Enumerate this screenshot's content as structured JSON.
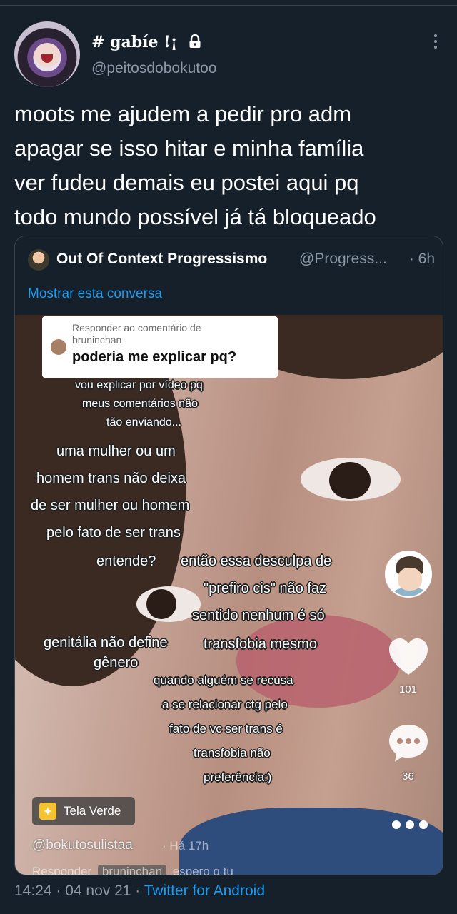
{
  "tweet": {
    "author_name": "# gabíe !¡",
    "author_handle": "@peitosdobokutoo",
    "text_lines": [
      "moots me ajudem a pedir pro adm",
      "apagar se isso hitar e minha família",
      "ver fudeu demais eu postei aqui pq",
      "todo mundo possível já tá bloqueado"
    ],
    "timestamp": "14:24 · 04 nov 21 ·",
    "source": "Twitter for Android"
  },
  "quote": {
    "name": "Out Of Context Progressismo",
    "handle": "@Progress...",
    "time": "· 6h",
    "show_thread": "Mostrar esta conversa"
  },
  "video": {
    "reply_label": "Responder ao comentário de",
    "reply_user": "bruninchan",
    "reply_question": "poderia me explicar pq?",
    "captions": [
      "vou explicar por vídeo pq",
      "meus comentários não",
      "tão enviando...",
      "uma mulher ou um",
      "homem trans não deixa",
      "de ser mulher ou homem",
      "pelo fato de ser trans",
      "entende?",
      "então essa desculpa de",
      "\"prefiro cis\" não faz",
      "sentido nenhum é só",
      "genitália não define",
      "gênero",
      "transfobia mesmo",
      "quando alguém se recusa",
      "a se relacionar ctg pelo",
      "fato de vc ser trans é",
      "transfobia não",
      "preferência:)"
    ],
    "like_count": "101",
    "comment_count": "36",
    "effect_label": "Tela Verde",
    "tiktok_user": "@bokutosulistaa",
    "posted_ago": "· Há 17h",
    "footer_prefix": "Responder",
    "footer_user": "bruninchan",
    "footer_suffix": "espero q tu"
  }
}
